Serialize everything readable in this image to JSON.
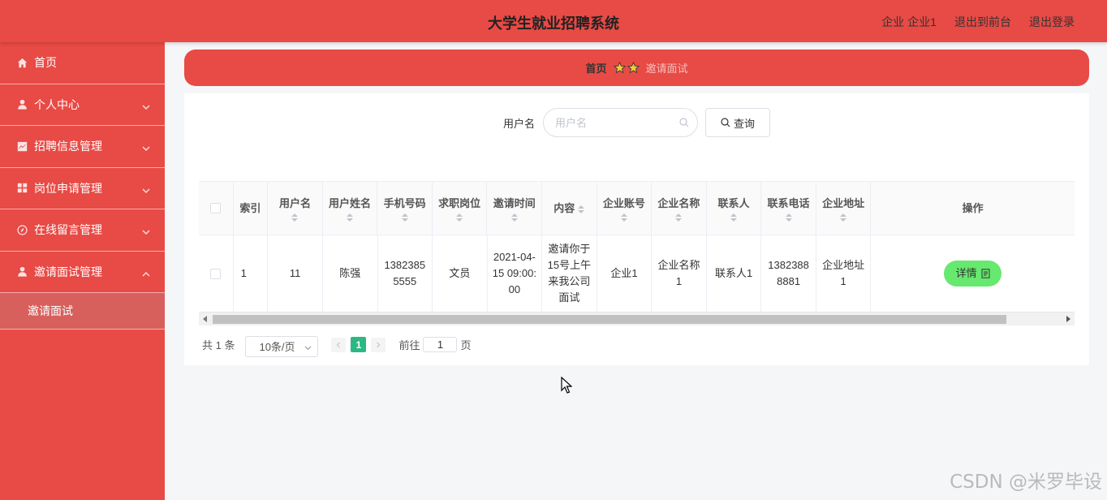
{
  "app": {
    "title": "大学生就业招聘系统",
    "user_label": "企业 企业1",
    "back_front": "退出到前台",
    "logout": "退出登录"
  },
  "colors": {
    "primary": "#e84a45",
    "submenu_active": "#d7605c",
    "detail_button": "#67e86f",
    "page_active": "#2bb884"
  },
  "sidebar": {
    "items": [
      {
        "label": "首页",
        "icon": "home-icon"
      },
      {
        "label": "个人中心",
        "icon": "user-icon"
      },
      {
        "label": "招聘信息管理",
        "icon": "chart-icon"
      },
      {
        "label": "岗位申请管理",
        "icon": "grid-icon"
      },
      {
        "label": "在线留言管理",
        "icon": "compass-icon"
      },
      {
        "label": "邀请面试管理",
        "icon": "user-icon"
      }
    ],
    "submenu": {
      "label": "邀请面试"
    }
  },
  "breadcrumb": {
    "home": "首页",
    "current": "邀请面试"
  },
  "search": {
    "label": "用户名",
    "placeholder": "用户名",
    "button": "查询"
  },
  "table": {
    "headers": [
      "索引",
      "用户名",
      "用户姓名",
      "手机号码",
      "求职岗位",
      "邀请时间",
      "内容",
      "企业账号",
      "企业名称",
      "联系人",
      "联系电话",
      "企业地址",
      "操作"
    ],
    "rows": [
      {
        "index": "1",
        "username": "11",
        "name": "陈强",
        "phone": "13823855555",
        "position": "文员",
        "time": "2021-04-15 09:00:00",
        "content": "邀请你于15号上午来我公司面试",
        "company_account": "企业1",
        "company_name": "企业名称1",
        "contact": "联系人1",
        "contact_phone": "13823888881",
        "company_address": "企业地址1",
        "action": "详情"
      }
    ]
  },
  "pagination": {
    "total": "共 1 条",
    "page_size": "10条/页",
    "current_page": "1",
    "goto_prefix": "前往",
    "goto_value": "1",
    "goto_suffix": "页"
  },
  "watermark": "CSDN @米罗毕设"
}
